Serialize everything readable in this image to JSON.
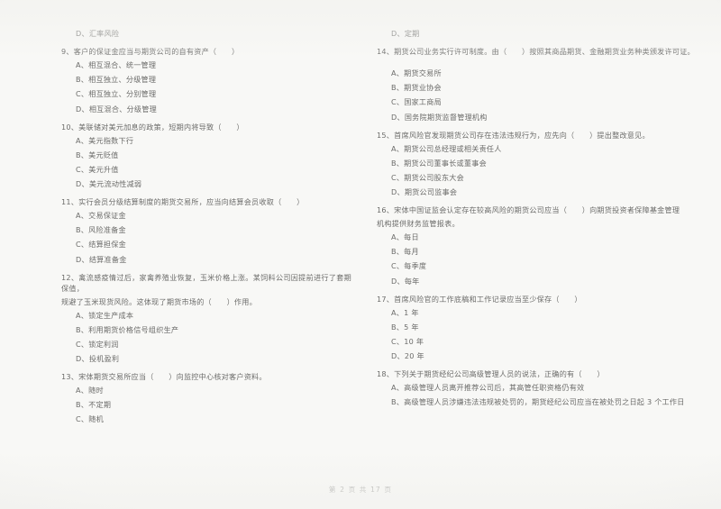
{
  "document": {
    "title": "期货法律法规试题 第2页",
    "footer": "第 2 页  共 17 页",
    "page_number": "2",
    "total_pages": "17",
    "ink_color": "#5e5e5c",
    "paper_color": "#fdfdfb"
  },
  "left_column": {
    "carryover_option": "D、汇率风险",
    "questions": [
      {
        "number": "9",
        "stem": "9、客户的保证金应当与期货公司的自有资产（　　）",
        "options": [
          "A、相互混合、统一管理",
          "B、相互独立、分级管理",
          "C、相互独立、分别管理",
          "D、相互混合、分级管理"
        ]
      },
      {
        "number": "10",
        "stem": "10、美联储对美元加息的政策，短期内将导致（　　）",
        "options": [
          "A、美元指数下行",
          "B、美元贬值",
          "C、美元升值",
          "D、美元流动性减弱"
        ]
      },
      {
        "number": "11",
        "stem": "11、实行会员分级结算制度的期货交易所，应当向结算会员收取（　　）",
        "options": [
          "A、交易保证金",
          "B、风险准备金",
          "C、结算担保金",
          "D、结算准备金"
        ]
      },
      {
        "number": "12",
        "stem": "12、禽流感疫情过后，家禽养殖业恢复，玉米价格上涨。某饲料公司因提前进行了套期保值，",
        "stem_line2": "规避了玉米现货风险。这体现了期货市场的（　　）作用。",
        "options": [
          "A、锁定生产成本",
          "B、利用期货价格信号组织生产",
          "C、锁定利润",
          "D、投机盈利"
        ]
      },
      {
        "number": "13",
        "stem": "13、宋体期货交易所应当（　　）向监控中心核对客户资料。",
        "options": [
          "A、随时",
          "B、不定期",
          "C、随机"
        ]
      }
    ]
  },
  "right_column": {
    "carryover_option": "D、定期",
    "questions": [
      {
        "number": "14",
        "stem": "14、期货公司业务实行许可制度。由（　　）按照其商品期货、金融期货业务种类颁发许可证。",
        "options": [
          "A、期货交易所",
          "B、期货业协会",
          "C、国家工商局",
          "D、国务院期货监督管理机构"
        ]
      },
      {
        "number": "15",
        "stem": "15、首席风险官发现期货公司存在违法违规行为，应先向（　　）提出整改意见。",
        "options": [
          "A、期货公司总经理或相关责任人",
          "B、期货公司董事长或董事会",
          "C、期货公司股东大会",
          "D、期货公司监事会"
        ]
      },
      {
        "number": "16",
        "stem": "16、宋体中国证监会认定存在较高风险的期货公司应当（　　）向期货投资者保障基金管理",
        "stem_line2": "机构提供财务监管报表。",
        "options": [
          "A、每日",
          "B、每月",
          "C、每季度",
          "D、每年"
        ]
      },
      {
        "number": "17",
        "stem": "17、首席风险官的工作底稿和工作记录应当至少保存（　　）",
        "options": [
          "A、1 年",
          "B、5 年",
          "C、10 年",
          "D、20 年"
        ]
      },
      {
        "number": "18",
        "stem": "18、下列关于期货经纪公司高级管理人员的说法，正确的有（　　）",
        "options": [
          "A、高级管理人员离开推荐公司后，其高管任职资格仍有效",
          "B、高级管理人员涉嫌违法违规被处罚的，期货经纪公司应当在被处罚之日起 3 个工作日"
        ]
      }
    ]
  }
}
